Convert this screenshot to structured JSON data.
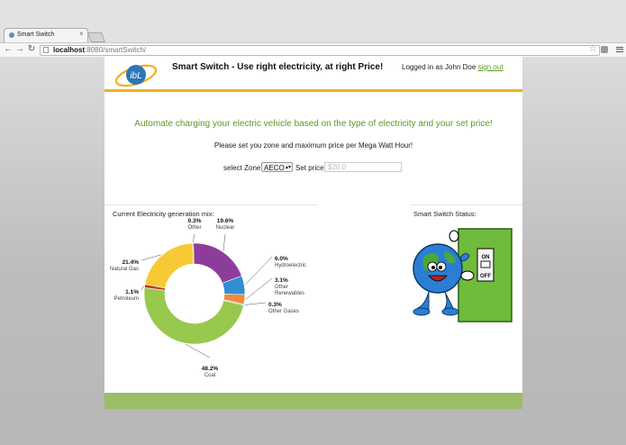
{
  "browser": {
    "tab_title": "Smart Switch",
    "url_host": "localhost",
    "url_rest": ":8080/smartSwitch/"
  },
  "header": {
    "logo_text": "ibL",
    "title": "Smart Switch - Use right electricity, at right Price!",
    "logged_in_text": "Logged in as John Doe",
    "signout_label": "sign out"
  },
  "main": {
    "headline": "Automate charging your electric vehicle based on the type of electricity and your set price!",
    "subline": "Please set you zone and maximum price per Mega Watt Hour!",
    "zone_label": "select Zone:",
    "zone_value": "AECO",
    "price_label": "Set price:",
    "price_placeholder": "$20.0"
  },
  "mix_title": "Current Electricity generation mix:",
  "status_title": "Smart Switch Status:",
  "switch_on_label": "ON",
  "switch_off_label": "OFF",
  "colors": {
    "accent_orange": "#f0b11c",
    "brand_green": "#5c9a26",
    "footer_green": "#9bbd67"
  },
  "chart_data": {
    "type": "pie",
    "style": "donut",
    "categories": [
      "Other",
      "Nuclear",
      "Hydroelectric",
      "Other Renewables",
      "Other Gases",
      "Coal",
      "Petroleum",
      "Natural Gas"
    ],
    "values": [
      0.3,
      19.6,
      6.0,
      3.1,
      0.3,
      48.2,
      1.1,
      21.4
    ],
    "value_labels": [
      "0.3%",
      "19.6%",
      "6.0%",
      "3.1%",
      "0.3%",
      "48.2%",
      "1.1%",
      "21.4%"
    ],
    "colors": [
      "#333333",
      "#8e3c9b",
      "#2f8fd0",
      "#f08a3c",
      "#2c8f8c",
      "#98c84c",
      "#c0392b",
      "#f7c935"
    ]
  }
}
